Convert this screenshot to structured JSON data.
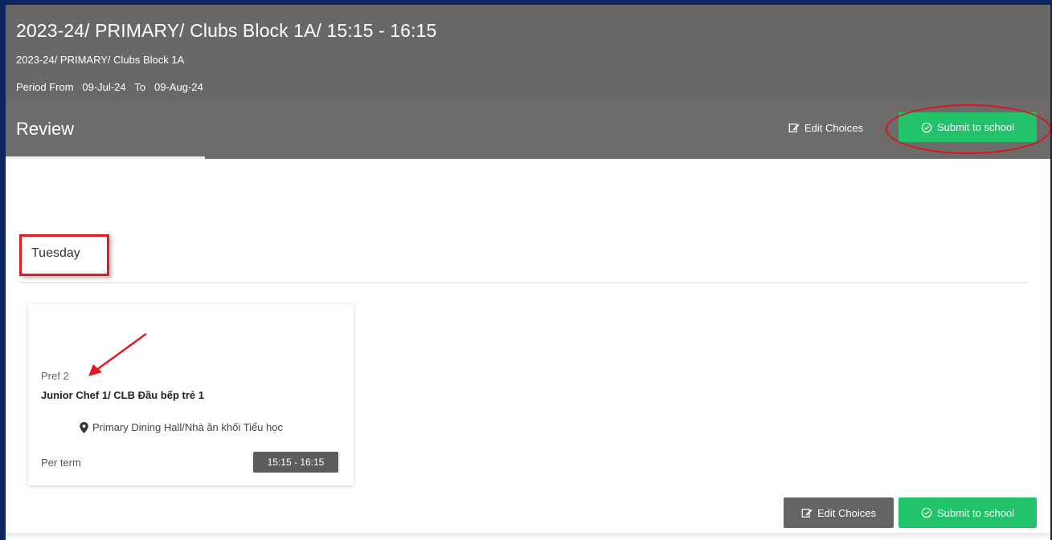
{
  "header": {
    "title": "2023-24/ PRIMARY/ Clubs Block 1A/ 15:15 - 16:15",
    "subtitle": "2023-24/ PRIMARY/ Clubs Block 1A",
    "period_from_label": "Period From",
    "period_from": "09-Jul-24",
    "period_to_label": "To",
    "period_to": "09-Aug-24"
  },
  "review": {
    "label": "Review"
  },
  "actions": {
    "edit_choices": "Edit Choices",
    "submit_to_school": "Submit to school"
  },
  "day": {
    "label": "Tuesday"
  },
  "choice_card": {
    "preference": "Pref 2",
    "club_name": "Junior Chef 1/ CLB Đầu bếp trẻ 1",
    "location": "Primary Dining Hall/Nhà ăn khối Tiểu học",
    "frequency": "Per term",
    "time": "15:15 - 16:15"
  },
  "icons": {
    "edit": "edit-icon",
    "submit": "check-circle-icon",
    "location": "map-pin-icon"
  },
  "colors": {
    "header_bg": "#6a6866",
    "submit_green": "#21c26a",
    "annotation_red": "#e01b24",
    "outer_bg": "#0d2660"
  }
}
